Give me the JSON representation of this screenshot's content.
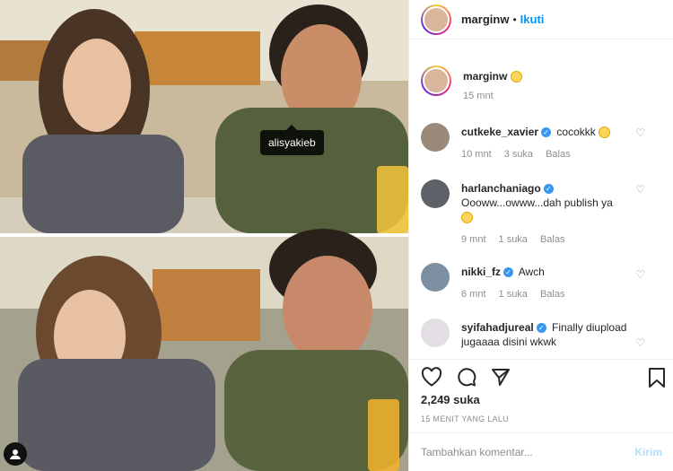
{
  "header": {
    "username": "marginw",
    "separator": "•",
    "follow_label": "Ikuti"
  },
  "caption": {
    "username": "marginw",
    "time": "15 mnt"
  },
  "image": {
    "tag_label": "alisyakieb"
  },
  "comments": [
    {
      "username": "cutkeke_xavier",
      "verified": true,
      "text": "cocokkk",
      "time": "10 mnt",
      "likes": "3 suka",
      "reply": "Balas"
    },
    {
      "username": "harlanchaniago",
      "verified": true,
      "text": "Oooww...owww...dah publish ya",
      "time": "9 mnt",
      "likes": "1 suka",
      "reply": "Balas"
    },
    {
      "username": "nikki_fz",
      "verified": true,
      "text": "Awch",
      "time": "6 mnt",
      "likes": "1 suka",
      "reply": "Balas"
    },
    {
      "username": "syifahadjureal",
      "verified": true,
      "text": "Finally diupload jugaaaa disini wkwk"
    }
  ],
  "likes_count": "2,249 suka",
  "timestamp": "15 MENIT YANG LALU",
  "add_comment": {
    "placeholder": "Tambahkan komentar...",
    "post_label": "Kirim"
  },
  "colors": {
    "accent": "#0095f6",
    "verified": "#3897f0",
    "post_disabled": "#b2dffc"
  },
  "icons": [
    "heart-icon",
    "comment-icon",
    "share-icon",
    "bookmark-icon",
    "user-tag-icon"
  ]
}
